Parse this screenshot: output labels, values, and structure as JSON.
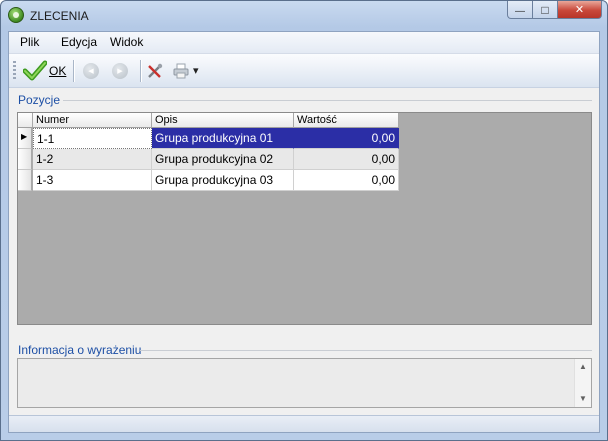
{
  "window": {
    "title": "ZLECENIA",
    "min_glyph": "—",
    "max_glyph": "□",
    "close_glyph": "✕"
  },
  "menu": {
    "items": [
      "Plik",
      "Edycja",
      "Widok"
    ]
  },
  "toolbar": {
    "ok_label": "OK",
    "icons": [
      "checkmark-icon",
      "back-icon",
      "forward-icon",
      "tools-icon",
      "print-icon",
      "dropdown-arrow-icon"
    ],
    "arrow_left": "◀",
    "arrow_right": "▶",
    "dropdown": "▾"
  },
  "positions": {
    "label": "Pozycje",
    "columns": [
      "Numer",
      "Opis",
      "Wartość"
    ],
    "rows": [
      {
        "numer": "1-1",
        "opis": "Grupa produkcyjna 01",
        "wartosc": "0,00",
        "selected": true
      },
      {
        "numer": "1-2",
        "opis": "Grupa produkcyjna 02",
        "wartosc": "0,00",
        "selected": false
      },
      {
        "numer": "1-3",
        "opis": "Grupa produkcyjna 03",
        "wartosc": "0,00",
        "selected": false
      }
    ],
    "row_marker": "▶"
  },
  "info": {
    "label": "Informacja o wyrażeniu",
    "value": ""
  },
  "colors": {
    "selection": "#2b2ea6",
    "group_label": "#1d4fa5",
    "ok_check": "#4caf2a"
  }
}
